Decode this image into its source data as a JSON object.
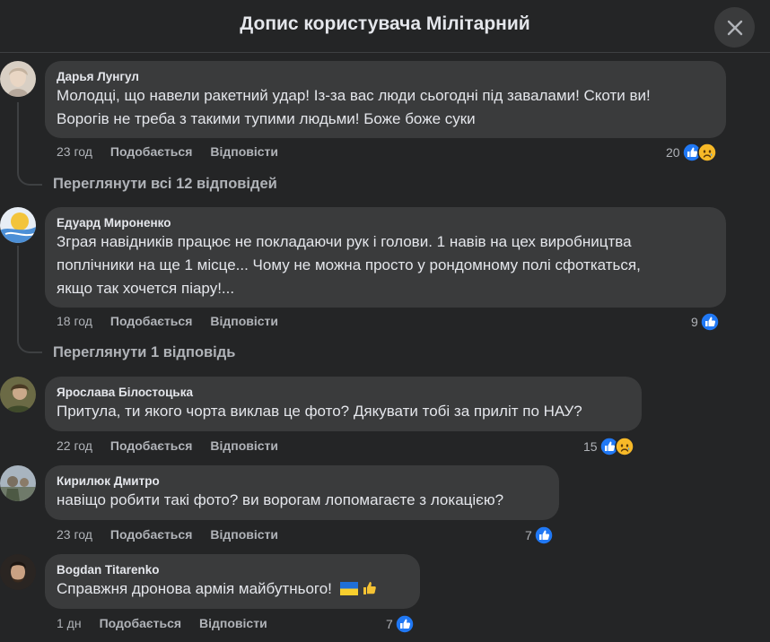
{
  "header": {
    "title": "Допис користувача Мілітарний"
  },
  "actions": {
    "like": "Подобається",
    "reply": "Відповісти"
  },
  "comments": [
    {
      "author": "Дарья Лунгул",
      "lines": [
        "Молодці, що навели ракетний удар! Із-за вас люди сьогодні під завалами! Скоти ви!",
        "Ворогів не треба з такими тупими людьми! Боже боже суки"
      ],
      "time": "23 год",
      "reactions": {
        "count": "20",
        "types": [
          "like",
          "sad"
        ]
      },
      "view_replies": "Переглянути всі 12 відповідей"
    },
    {
      "author": "Едуард Мироненко",
      "lines": [
        "Зграя навідників працює не покладаючи рук і голови. 1 навів на цех виробництва",
        "поплічники на ще 1 місце... Чому не можна просто у рондомному полі сфоткаться,",
        "якщо так хочется піару!..."
      ],
      "time": "18 год",
      "reactions": {
        "count": "9",
        "types": [
          "like"
        ]
      },
      "view_replies": "Переглянути 1 відповідь"
    },
    {
      "author": "Ярослава Білостоцька",
      "lines": [
        "Притула, ти якого чорта виклав це фото? Дякувати тобі за приліт по НАУ?"
      ],
      "time": "22 год",
      "reactions": {
        "count": "15",
        "types": [
          "like",
          "sad"
        ]
      }
    },
    {
      "author": "Кирилюк Дмитро",
      "lines": [
        "навіщо робити такі фото? ви ворогам лопомагаєте з локацією?"
      ],
      "time": "23 год",
      "reactions": {
        "count": "7",
        "types": [
          "like"
        ]
      }
    },
    {
      "author": "Bogdan Titarenko",
      "lines": [
        "Справжня дронова армія майбутнього!"
      ],
      "emoji": [
        "flag-ukraine",
        "thumbs-up"
      ],
      "time": "1 дн",
      "reactions": {
        "count": "7",
        "types": [
          "like"
        ]
      }
    }
  ],
  "colors": {
    "background": "#242526",
    "bubble": "#3a3b3c",
    "like": "#2078f4",
    "sad": "#f7b928",
    "secondary_text": "#b0b3b8"
  }
}
